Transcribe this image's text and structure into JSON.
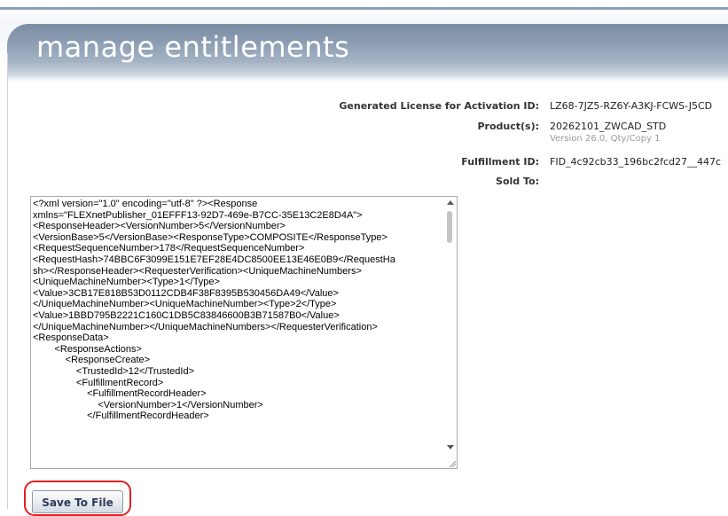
{
  "page": {
    "title": "manage entitlements"
  },
  "license": {
    "activation_label": "Generated License for Activation ID:",
    "activation_id": "LZ68-7JZ5-RZ6Y-A3KJ-FCWS-J5CD",
    "products_label": "Product(s):",
    "product_name": "20262101_ZWCAD_STD",
    "product_detail": "Version 26.0, Qty/Copy 1",
    "fulfillment_label": "Fulfillment ID:",
    "fulfillment_id": "FID_4c92cb33_196bc2fcd27__447c",
    "sold_to_label": "Sold To:",
    "sold_to_value": ""
  },
  "xml_content": "<?xml version=\"1.0\" encoding=\"utf-8\" ?><Response\nxmlns=\"FLEXnetPublisher_01EFFF13-92D7-469e-B7CC-35E13C2E8D4A\">\n<ResponseHeader><VersionNumber>5</VersionNumber>\n<VersionBase>5</VersionBase><ResponseType>COMPOSITE</ResponseType>\n<RequestSequenceNumber>178</RequestSequenceNumber>\n<RequestHash>74BBC6F3099E151E7EF28E4DC8500EE13E46E0B9</RequestHa\nsh></ResponseHeader><RequesterVerification><UniqueMachineNumbers>\n<UniqueMachineNumber><Type>1</Type>\n<Value>3CB17E818B53D0112CDB4F38F8395B530456DA49</Value>\n</UniqueMachineNumber><UniqueMachineNumber><Type>2</Type>\n<Value>1BBD795B2221C160C1DB5C83846600B3B71587B0</Value>\n</UniqueMachineNumber></UniqueMachineNumbers></RequesterVerification>\n<ResponseData>\n        <ResponseActions>\n            <ResponseCreate>\n                <TrustedId>12</TrustedId>\n                <FulfillmentRecord>\n                    <FulfillmentRecordHeader>\n                        <VersionNumber>1</VersionNumber>\n                    </FulfillmentRecordHeader>",
  "actions": {
    "save_label": "Save To File"
  }
}
